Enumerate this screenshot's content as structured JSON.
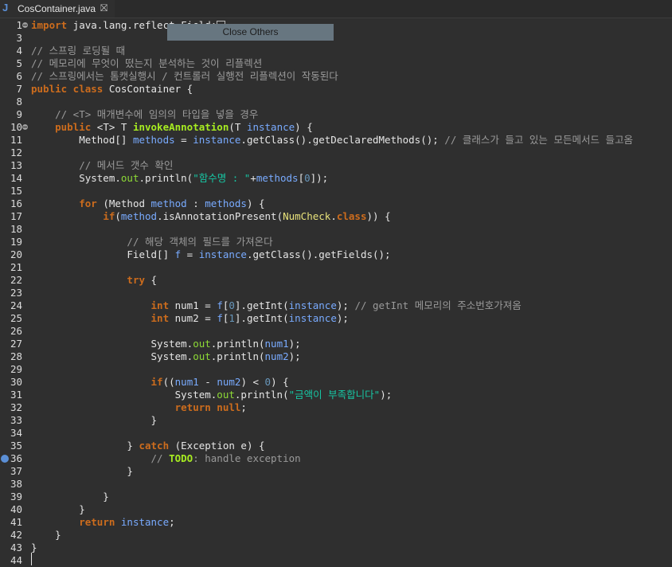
{
  "tab": {
    "icon_glyph": "J",
    "title": "CosContainer.java",
    "close_glyph": "⛝"
  },
  "tooltip": {
    "label": "Close Others"
  },
  "lines": [
    {
      "n": "1",
      "code": "<span class='kw'>import</span> java.lang.reflect.Field;<span class='cursor-box'></span>",
      "fold": true
    },
    {
      "n": "3",
      "code": ""
    },
    {
      "n": "4",
      "code": "<span class='cm'>// 스프링 로딩될 때</span>"
    },
    {
      "n": "5",
      "code": "<span class='cm'>// 메모리에 무엇이 떴는지 분석하는 것이 리플렉션</span>"
    },
    {
      "n": "6",
      "code": "<span class='cm'>// 스프링에서는 톰캣실행시 / 컨트롤러 실행전 리플렉션이 작동된다</span>"
    },
    {
      "n": "7",
      "code": "<span class='kw'>public class</span> CosContainer {"
    },
    {
      "n": "8",
      "code": ""
    },
    {
      "n": "9",
      "code": "    <span class='cm'>// &lt;T&gt; 매개변수에 임의의 타입을 넣을 경우</span>"
    },
    {
      "n": "10",
      "code": "    <span class='kw'>public</span> &lt;T&gt; T <span class='fn'>invokeAnnotation</span>(T <span class='var'>instance</span>) {",
      "fold": true
    },
    {
      "n": "11",
      "code": "        Method[] <span class='var'>methods</span> = <span class='var'>instance</span>.getClass().getDeclaredMethods(); <span class='cm'>// 클래스가 들고 있는 모든메서드 들고옴</span>"
    },
    {
      "n": "12",
      "code": ""
    },
    {
      "n": "13",
      "code": "        <span class='cm'>// 메서드 갯수 확인</span>"
    },
    {
      "n": "14",
      "code": "        System.<span class='field'>out</span>.println(<span class='str'>\"함수명 : \"</span>+<span class='var'>methods</span>[<span class='num'>0</span>]);"
    },
    {
      "n": "15",
      "code": ""
    },
    {
      "n": "16",
      "code": "        <span class='kw'>for</span> (Method <span class='var'>method</span> : <span class='var'>methods</span>) {"
    },
    {
      "n": "17",
      "code": "            <span class='kw'>if</span>(<span class='var'>method</span>.isAnnotationPresent(<span class='anno'>NumCheck</span>.<span class='kw'>class</span>)) {"
    },
    {
      "n": "18",
      "code": ""
    },
    {
      "n": "19",
      "code": "                <span class='cm'>// 해당 객체의 필드를 가져온다</span>"
    },
    {
      "n": "20",
      "code": "                Field[] <span class='var'>f</span> = <span class='var'>instance</span>.getClass().getFields();"
    },
    {
      "n": "21",
      "code": ""
    },
    {
      "n": "22",
      "code": "                <span class='kw'>try</span> {"
    },
    {
      "n": "23",
      "code": ""
    },
    {
      "n": "24",
      "code": "                    <span class='kw'>int</span> num1 = <span class='var'>f</span>[<span class='num'>0</span>].getInt(<span class='var'>instance</span>); <span class='cm'>// getInt 메모리의 주소번호가져옴</span>"
    },
    {
      "n": "25",
      "code": "                    <span class='kw'>int</span> num2 = <span class='var'>f</span>[<span class='num'>1</span>].getInt(<span class='var'>instance</span>);"
    },
    {
      "n": "26",
      "code": ""
    },
    {
      "n": "27",
      "code": "                    System.<span class='field'>out</span>.println(<span class='var'>num1</span>);"
    },
    {
      "n": "28",
      "code": "                    System.<span class='field'>out</span>.println(<span class='var'>num2</span>);"
    },
    {
      "n": "29",
      "code": ""
    },
    {
      "n": "30",
      "code": "                    <span class='kw'>if</span>((<span class='var'>num1</span> - <span class='var'>num2</span>) &lt; <span class='num'>0</span>) {"
    },
    {
      "n": "31",
      "code": "                        System.<span class='field'>out</span>.println(<span class='str'>\"금액이 부족합니다\"</span>);"
    },
    {
      "n": "32",
      "code": "                        <span class='kw'>return null</span>;"
    },
    {
      "n": "33",
      "code": "                    }"
    },
    {
      "n": "34",
      "code": ""
    },
    {
      "n": "35",
      "code": "                } <span class='kw'>catch</span> (Exception e) {"
    },
    {
      "n": "36",
      "code": "                    <span class='cm'>// </span><span class='todo'>TODO</span><span class='cm'>: handle exception</span>",
      "bookmark": true
    },
    {
      "n": "37",
      "code": "                }"
    },
    {
      "n": "38",
      "code": ""
    },
    {
      "n": "39",
      "code": "            }"
    },
    {
      "n": "40",
      "code": "        }"
    },
    {
      "n": "41",
      "code": "        <span class='kw'>return</span> <span class='var'>instance</span>;"
    },
    {
      "n": "42",
      "code": "    }"
    },
    {
      "n": "43",
      "code": "}"
    },
    {
      "n": "44",
      "code": ""
    }
  ]
}
